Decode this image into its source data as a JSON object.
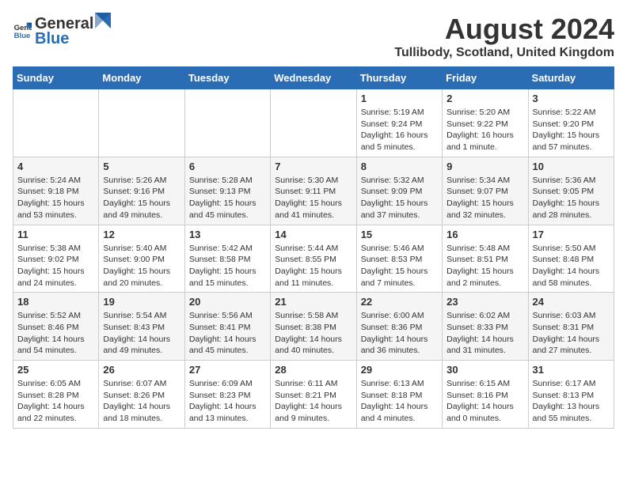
{
  "header": {
    "logo_general": "General",
    "logo_blue": "Blue",
    "main_title": "August 2024",
    "subtitle": "Tullibody, Scotland, United Kingdom"
  },
  "calendar": {
    "days_of_week": [
      "Sunday",
      "Monday",
      "Tuesday",
      "Wednesday",
      "Thursday",
      "Friday",
      "Saturday"
    ],
    "weeks": [
      [
        {
          "day": "",
          "info": ""
        },
        {
          "day": "",
          "info": ""
        },
        {
          "day": "",
          "info": ""
        },
        {
          "day": "",
          "info": ""
        },
        {
          "day": "1",
          "info": "Sunrise: 5:19 AM\nSunset: 9:24 PM\nDaylight: 16 hours\nand 5 minutes."
        },
        {
          "day": "2",
          "info": "Sunrise: 5:20 AM\nSunset: 9:22 PM\nDaylight: 16 hours\nand 1 minute."
        },
        {
          "day": "3",
          "info": "Sunrise: 5:22 AM\nSunset: 9:20 PM\nDaylight: 15 hours\nand 57 minutes."
        }
      ],
      [
        {
          "day": "4",
          "info": "Sunrise: 5:24 AM\nSunset: 9:18 PM\nDaylight: 15 hours\nand 53 minutes."
        },
        {
          "day": "5",
          "info": "Sunrise: 5:26 AM\nSunset: 9:16 PM\nDaylight: 15 hours\nand 49 minutes."
        },
        {
          "day": "6",
          "info": "Sunrise: 5:28 AM\nSunset: 9:13 PM\nDaylight: 15 hours\nand 45 minutes."
        },
        {
          "day": "7",
          "info": "Sunrise: 5:30 AM\nSunset: 9:11 PM\nDaylight: 15 hours\nand 41 minutes."
        },
        {
          "day": "8",
          "info": "Sunrise: 5:32 AM\nSunset: 9:09 PM\nDaylight: 15 hours\nand 37 minutes."
        },
        {
          "day": "9",
          "info": "Sunrise: 5:34 AM\nSunset: 9:07 PM\nDaylight: 15 hours\nand 32 minutes."
        },
        {
          "day": "10",
          "info": "Sunrise: 5:36 AM\nSunset: 9:05 PM\nDaylight: 15 hours\nand 28 minutes."
        }
      ],
      [
        {
          "day": "11",
          "info": "Sunrise: 5:38 AM\nSunset: 9:02 PM\nDaylight: 15 hours\nand 24 minutes."
        },
        {
          "day": "12",
          "info": "Sunrise: 5:40 AM\nSunset: 9:00 PM\nDaylight: 15 hours\nand 20 minutes."
        },
        {
          "day": "13",
          "info": "Sunrise: 5:42 AM\nSunset: 8:58 PM\nDaylight: 15 hours\nand 15 minutes."
        },
        {
          "day": "14",
          "info": "Sunrise: 5:44 AM\nSunset: 8:55 PM\nDaylight: 15 hours\nand 11 minutes."
        },
        {
          "day": "15",
          "info": "Sunrise: 5:46 AM\nSunset: 8:53 PM\nDaylight: 15 hours\nand 7 minutes."
        },
        {
          "day": "16",
          "info": "Sunrise: 5:48 AM\nSunset: 8:51 PM\nDaylight: 15 hours\nand 2 minutes."
        },
        {
          "day": "17",
          "info": "Sunrise: 5:50 AM\nSunset: 8:48 PM\nDaylight: 14 hours\nand 58 minutes."
        }
      ],
      [
        {
          "day": "18",
          "info": "Sunrise: 5:52 AM\nSunset: 8:46 PM\nDaylight: 14 hours\nand 54 minutes."
        },
        {
          "day": "19",
          "info": "Sunrise: 5:54 AM\nSunset: 8:43 PM\nDaylight: 14 hours\nand 49 minutes."
        },
        {
          "day": "20",
          "info": "Sunrise: 5:56 AM\nSunset: 8:41 PM\nDaylight: 14 hours\nand 45 minutes."
        },
        {
          "day": "21",
          "info": "Sunrise: 5:58 AM\nSunset: 8:38 PM\nDaylight: 14 hours\nand 40 minutes."
        },
        {
          "day": "22",
          "info": "Sunrise: 6:00 AM\nSunset: 8:36 PM\nDaylight: 14 hours\nand 36 minutes."
        },
        {
          "day": "23",
          "info": "Sunrise: 6:02 AM\nSunset: 8:33 PM\nDaylight: 14 hours\nand 31 minutes."
        },
        {
          "day": "24",
          "info": "Sunrise: 6:03 AM\nSunset: 8:31 PM\nDaylight: 14 hours\nand 27 minutes."
        }
      ],
      [
        {
          "day": "25",
          "info": "Sunrise: 6:05 AM\nSunset: 8:28 PM\nDaylight: 14 hours\nand 22 minutes."
        },
        {
          "day": "26",
          "info": "Sunrise: 6:07 AM\nSunset: 8:26 PM\nDaylight: 14 hours\nand 18 minutes."
        },
        {
          "day": "27",
          "info": "Sunrise: 6:09 AM\nSunset: 8:23 PM\nDaylight: 14 hours\nand 13 minutes."
        },
        {
          "day": "28",
          "info": "Sunrise: 6:11 AM\nSunset: 8:21 PM\nDaylight: 14 hours\nand 9 minutes."
        },
        {
          "day": "29",
          "info": "Sunrise: 6:13 AM\nSunset: 8:18 PM\nDaylight: 14 hours\nand 4 minutes."
        },
        {
          "day": "30",
          "info": "Sunrise: 6:15 AM\nSunset: 8:16 PM\nDaylight: 14 hours\nand 0 minutes."
        },
        {
          "day": "31",
          "info": "Sunrise: 6:17 AM\nSunset: 8:13 PM\nDaylight: 13 hours\nand 55 minutes."
        }
      ]
    ]
  }
}
